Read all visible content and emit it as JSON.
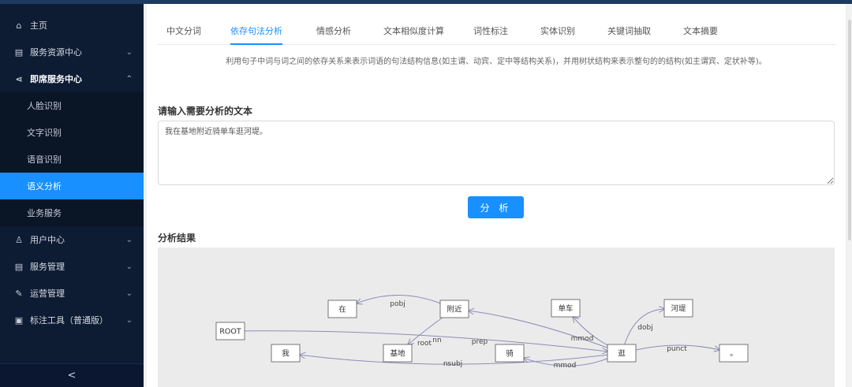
{
  "sidebar": {
    "items": [
      {
        "label": "主页",
        "icon": "home-icon",
        "glyph": "⌂",
        "has_chevron": false
      },
      {
        "label": "服务资源中心",
        "icon": "document-icon",
        "glyph": "▤",
        "has_chevron": true,
        "chevron": "⌄"
      },
      {
        "label": "即席服务中心",
        "icon": "share-icon",
        "glyph": "⋖",
        "has_chevron": true,
        "chevron": "⌃"
      },
      {
        "label": "用户中心",
        "icon": "user-icon",
        "glyph": "♙",
        "has_chevron": true,
        "chevron": "⌄"
      },
      {
        "label": "服务管理",
        "icon": "list-icon",
        "glyph": "▤",
        "has_chevron": true,
        "chevron": "⌄"
      },
      {
        "label": "运营管理",
        "icon": "wrench-icon",
        "glyph": "✎",
        "has_chevron": true,
        "chevron": "⌄"
      },
      {
        "label": "标注工具（普通版）",
        "icon": "image-icon",
        "glyph": "▣",
        "has_chevron": true,
        "chevron": "⌄"
      }
    ],
    "subitems": [
      "人脸识别",
      "文字识别",
      "语音识别",
      "语义分析",
      "业务服务"
    ],
    "collapse_glyph": "<"
  },
  "tabs": [
    "中文分词",
    "依存句法分析",
    "情感分析",
    "文本相似度计算",
    "词性标注",
    "实体识别",
    "关键词抽取",
    "文本摘要"
  ],
  "description": "利用句子中词与词之间的依存关系来表示词语的句法结构信息(如主谓、动宾、定中等结构关系)，并用树状结构来表示整句的的结构(如主谓宾、定状补等)。",
  "input_title": "请输入需要分析的文本",
  "input_value": "我在基地附近骑单车逛河堤。",
  "analyze_label": "分 析",
  "result_title": "分析结果",
  "graph": {
    "nodes": [
      "ROOT",
      "在",
      "附近",
      "我",
      "基地",
      "骑",
      "单车",
      "逛",
      "河堤",
      "。"
    ],
    "edges": [
      {
        "from": "附近",
        "to": "在",
        "label": "pobj"
      },
      {
        "from": "逛",
        "to": "附近",
        "label": "prep"
      },
      {
        "from": "附近",
        "to": "基地",
        "label": "nn"
      },
      {
        "from": "ROOT",
        "to": "逛",
        "label": "root"
      },
      {
        "from": "逛",
        "to": "我",
        "label": "nsubj"
      },
      {
        "from": "逛",
        "to": "单车",
        "label": "mmod"
      },
      {
        "from": "逛",
        "to": "骑",
        "label": "mmod"
      },
      {
        "from": "逛",
        "to": "河堤",
        "label": "dobj"
      },
      {
        "from": "逛",
        "to": "。",
        "label": "punct"
      }
    ]
  },
  "colors": {
    "accent": "#1890ff",
    "sidebar": "#0d1b33",
    "edge": "#8c8cb8"
  }
}
